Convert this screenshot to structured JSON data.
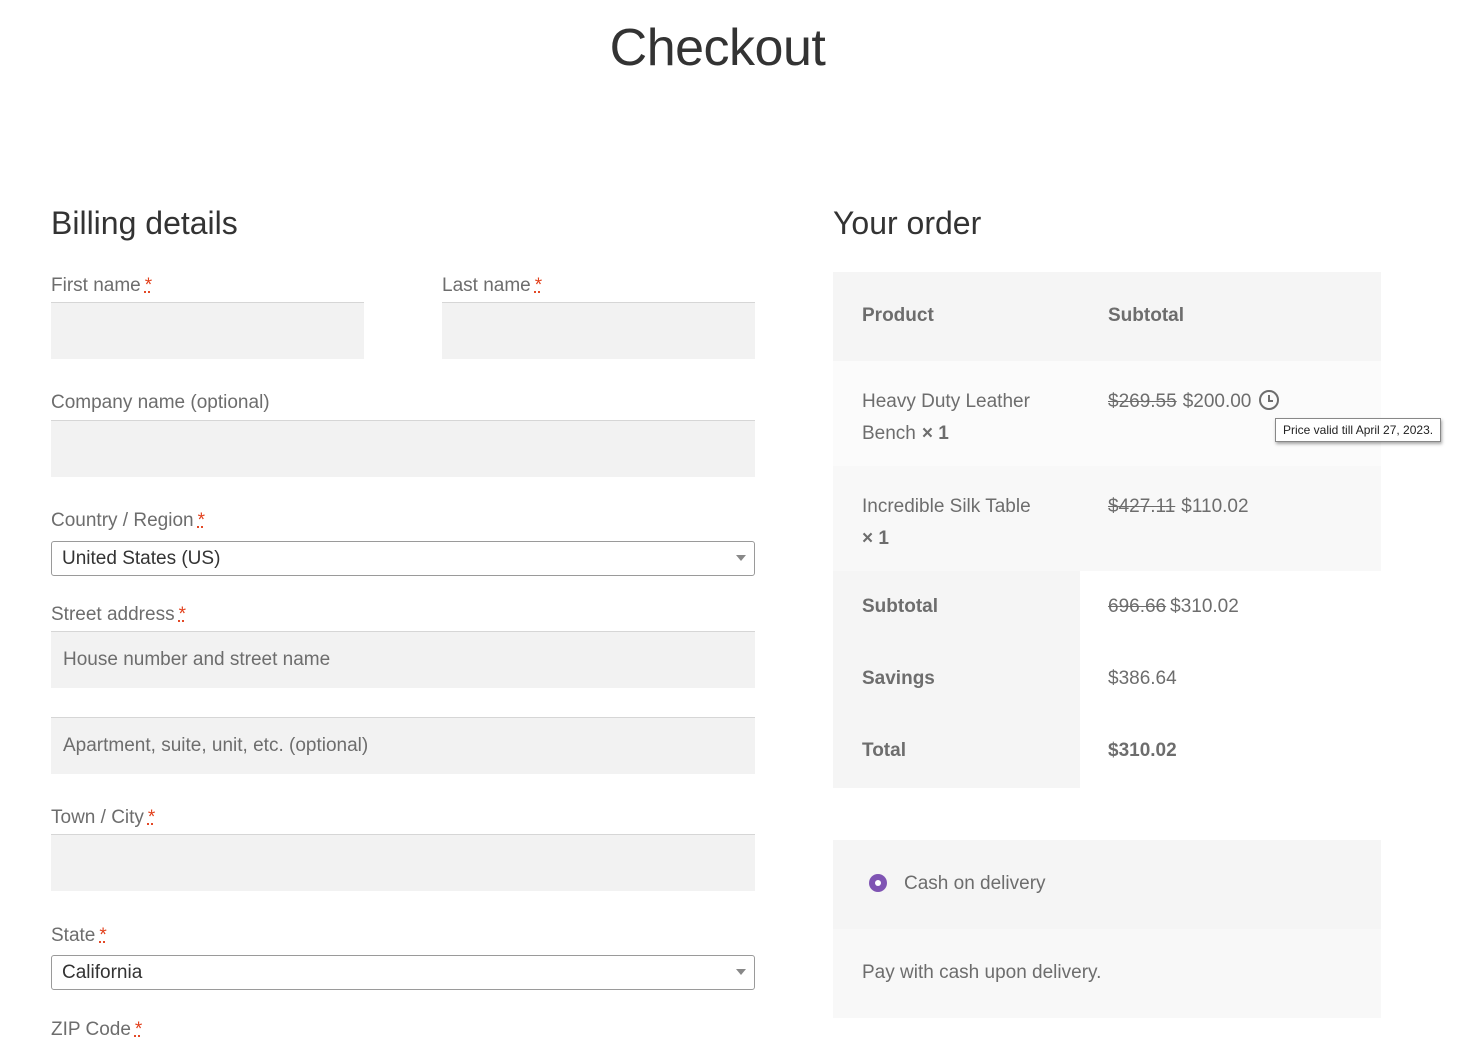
{
  "page": {
    "title": "Checkout"
  },
  "billing": {
    "title": "Billing details",
    "first_name": {
      "label": "First name",
      "required": "*",
      "value": ""
    },
    "last_name": {
      "label": "Last name",
      "required": "*",
      "value": ""
    },
    "company": {
      "label": "Company name (optional)",
      "value": ""
    },
    "country": {
      "label": "Country / Region",
      "required": "*",
      "value": "United States (US)"
    },
    "street": {
      "label": "Street address",
      "required": "*",
      "placeholder1": "House number and street name",
      "placeholder2": "Apartment, suite, unit, etc. (optional)"
    },
    "city": {
      "label": "Town / City",
      "required": "*",
      "value": ""
    },
    "state": {
      "label": "State",
      "required": "*",
      "value": "California"
    },
    "zip": {
      "label": "ZIP Code",
      "required": "*"
    }
  },
  "order": {
    "title": "Your order",
    "head": {
      "product": "Product",
      "subtotal": "Subtotal"
    },
    "items": [
      {
        "name_line1": "Heavy Duty Leather",
        "name_line2": "Bench",
        "qty": "× 1",
        "old_price": "$269.55",
        "price": "$200.00"
      },
      {
        "name_line1": "Incredible Silk Table",
        "name_line2": "",
        "qty": "× 1",
        "old_price": "$427.11",
        "price": "$110.02"
      }
    ],
    "subtotal": {
      "label": "Subtotal",
      "old": "696.66",
      "value": "$310.02"
    },
    "savings": {
      "label": "Savings",
      "value": "$386.64"
    },
    "total": {
      "label": "Total",
      "value": "$310.02"
    },
    "tooltip": "Price valid till April 27, 2023."
  },
  "payment": {
    "method": "Cash on delivery",
    "description": "Pay with cash upon delivery."
  },
  "colors": {
    "accent": "#7f54b3",
    "required": "#e2401c",
    "field_bg": "#f2f2f2",
    "table_bg": "#f8f8f8"
  }
}
